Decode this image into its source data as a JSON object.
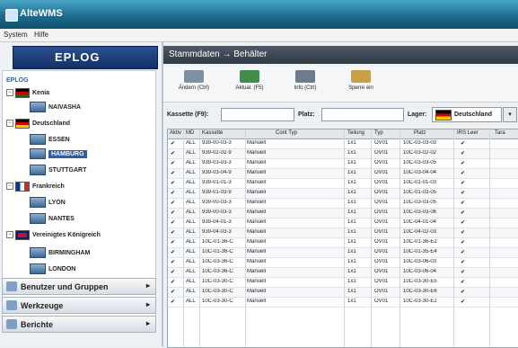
{
  "window": {
    "title": "AlteWMS"
  },
  "menu": {
    "items": [
      "System",
      "Hilfe"
    ]
  },
  "sidebar": {
    "logo": "EPLOG",
    "tree": [
      {
        "label": "EPLOG",
        "type": "root"
      },
      {
        "label": "Kenia",
        "type": "country",
        "flag": "ke"
      },
      {
        "label": "NAIVASHA",
        "type": "warehouse"
      },
      {
        "label": "Deutschland",
        "type": "country",
        "flag": "de"
      },
      {
        "label": "ESSEN",
        "type": "warehouse"
      },
      {
        "label": "HAMBURG",
        "type": "warehouse",
        "selected": true
      },
      {
        "label": "STUTTGART",
        "type": "warehouse"
      },
      {
        "label": "Frankreich",
        "type": "country",
        "flag": "fr"
      },
      {
        "label": "LYON",
        "type": "warehouse"
      },
      {
        "label": "NANTES",
        "type": "warehouse"
      },
      {
        "label": "Vereinigtes Königreich",
        "type": "country",
        "flag": "uk"
      },
      {
        "label": "BIRMINGHAM",
        "type": "warehouse"
      },
      {
        "label": "LONDON",
        "type": "warehouse"
      }
    ],
    "nav": [
      {
        "label": "Benutzer und Gruppen",
        "icon": "users-icon"
      },
      {
        "label": "Werkzeuge",
        "icon": "tools-icon"
      },
      {
        "label": "Berichte",
        "icon": "reports-icon"
      }
    ]
  },
  "main": {
    "breadcrumb": "Stammdaten → Behälter",
    "toolbar": [
      {
        "label": "Ändern (Ctrl)",
        "icon": "edit-icon",
        "color": "#7d8fa3"
      },
      {
        "label": "Aktual. (F5)",
        "icon": "refresh-icon",
        "color": "#3f8f4a"
      },
      {
        "label": "Info (Ctrl)",
        "icon": "info-icon",
        "color": "#6b7c8e"
      },
      {
        "label": "Sperre ein",
        "icon": "lock-icon",
        "color": "#c8a046"
      }
    ],
    "filter": {
      "kassette_label": "Kassette (F9):",
      "platz_label": "Platz:",
      "lager_label": "Lager:",
      "lager_value": "Deutschland"
    },
    "table": {
      "columns": [
        "Aktiv",
        "MD",
        "Kassette",
        "Cont Typ",
        "Teilung",
        "Typ",
        "Platz",
        "IRS Leer",
        "Tara"
      ],
      "rows": [
        [
          "✔",
          "ALL",
          "939-00-03-3",
          "Manuell",
          "1x1",
          "OV01",
          "10C-03-03-03",
          "✔",
          ""
        ],
        [
          "✔",
          "ALL",
          "939-02-02-9",
          "Manuell",
          "1x1",
          "OV01",
          "10C-03-02-02",
          "✔",
          ""
        ],
        [
          "✔",
          "ALL",
          "939-03-03-3",
          "Manuell",
          "1x1",
          "OV01",
          "10C-03-03-05",
          "✔",
          ""
        ],
        [
          "✔",
          "ALL",
          "939-03-04-9",
          "Manuell",
          "1x1",
          "OV01",
          "10C-03-04-04",
          "✔",
          ""
        ],
        [
          "✔",
          "ALL",
          "939-01-01-3",
          "Manuell",
          "1x1",
          "OV01",
          "10C-01-01-03",
          "✔",
          ""
        ],
        [
          "✔",
          "ALL",
          "939-01-03-9",
          "Manuell",
          "1x1",
          "OV01",
          "10C-01-03-05",
          "✔",
          ""
        ],
        [
          "✔",
          "ALL",
          "939-00-03-3",
          "Manuell",
          "1x1",
          "OV01",
          "10C-03-03-05",
          "✔",
          ""
        ],
        [
          "✔",
          "ALL",
          "939-00-03-3",
          "Manuell",
          "1x1",
          "OV01",
          "10C-03-03-06",
          "✔",
          ""
        ],
        [
          "✔",
          "ALL",
          "939-04-01-3",
          "Manuell",
          "1x1",
          "OV01",
          "10C-04-01-04",
          "✔",
          ""
        ],
        [
          "✔",
          "ALL",
          "939-04-03-3",
          "Manuell",
          "1x1",
          "OV01",
          "10C-04-02-03",
          "✔",
          ""
        ],
        [
          "✔",
          "ALL",
          "10C-01-36-C",
          "Manuell",
          "1x1",
          "OV01",
          "10C-01-36-E2",
          "✔",
          ""
        ],
        [
          "✔",
          "ALL",
          "10C-01-36-C",
          "Manuell",
          "1x1",
          "OV01",
          "10C-01-35-E4",
          "✔",
          ""
        ],
        [
          "✔",
          "ALL",
          "10C-03-36-C",
          "Manuell",
          "1x1",
          "OV01",
          "10C-03-06-03",
          "✔",
          ""
        ],
        [
          "✔",
          "ALL",
          "10C-03-36-C",
          "Manuell",
          "1x1",
          "OV01",
          "10C-03-06-04",
          "✔",
          ""
        ],
        [
          "✔",
          "ALL",
          "10C-03-30-C",
          "Manuell",
          "1x1",
          "OV01",
          "10C-03-30-E5",
          "✔",
          ""
        ],
        [
          "✔",
          "ALL",
          "10C-03-30-C",
          "Manuell",
          "1x1",
          "OV01",
          "10C-03-30-E6",
          "✔",
          ""
        ],
        [
          "✔",
          "ALL",
          "10C-03-30-C",
          "Manuell",
          "1x1",
          "OV01",
          "10C-03-30-E2",
          "✔",
          ""
        ]
      ]
    }
  }
}
